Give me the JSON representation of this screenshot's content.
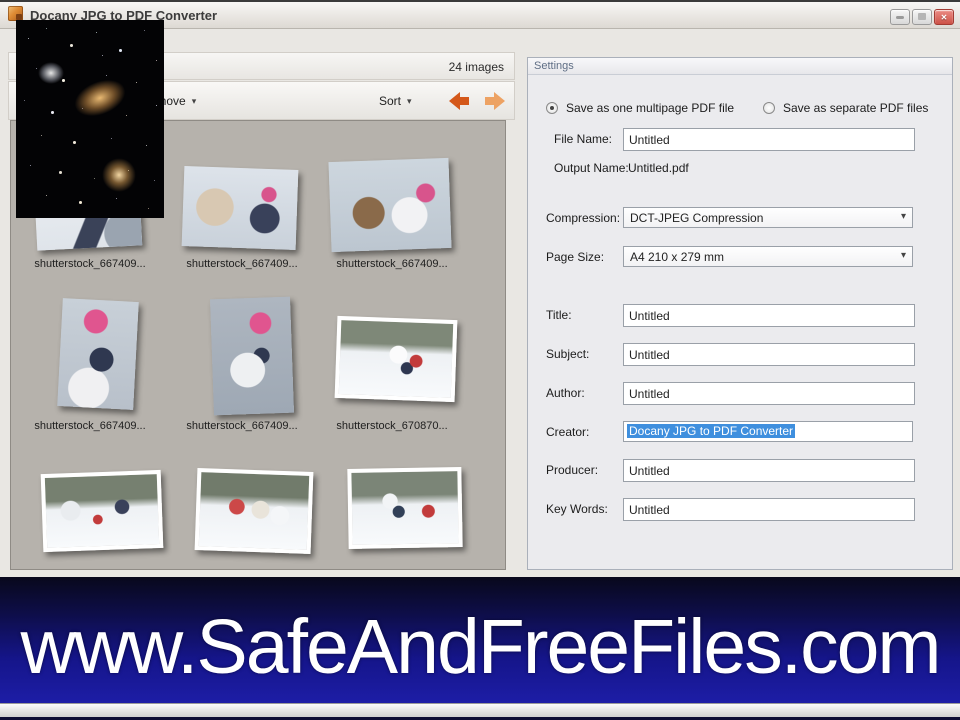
{
  "titlebar": {
    "title": "Docany JPG to PDF Converter",
    "close_glyph": "✕"
  },
  "gallery": {
    "count_label": "24 images",
    "remove_label": "Remove",
    "sort_label": "Sort",
    "caret_glyph": "▾",
    "scroll_up_glyph": "▴",
    "rows": [
      {
        "items": [
          {
            "label": "shutterstock_667409..."
          },
          {
            "label": "shutterstock_667409..."
          },
          {
            "label": "shutterstock_667409..."
          }
        ]
      },
      {
        "items": [
          {
            "label": "shutterstock_667409..."
          },
          {
            "label": "shutterstock_667409..."
          },
          {
            "label": "shutterstock_670870..."
          }
        ]
      },
      {
        "items": [
          {
            "label": ""
          },
          {
            "label": ""
          },
          {
            "label": ""
          }
        ]
      }
    ]
  },
  "overlay_image": {
    "description": "deep space star field photo overlay"
  },
  "settings": {
    "header": "Settings",
    "radio_multipage_label": "Save as one multipage PDF file",
    "radio_separate_label": "Save as separate PDF files",
    "file_name_label": "File Name:",
    "file_name_value": "Untitled",
    "output_name_label": "Output Name:",
    "output_name_value": "Untitled.pdf",
    "compression_label": "Compression:",
    "compression_value": "DCT-JPEG Compression",
    "page_size_label": "Page Size:",
    "page_size_value": "A4 210 x 279 mm",
    "fields": [
      {
        "label": "Title:",
        "value": "Untitled"
      },
      {
        "label": "Subject:",
        "value": "Untitled"
      },
      {
        "label": "Author:",
        "value": "Untitled"
      },
      {
        "label": "Creator:",
        "value": "Docany JPG to PDF Converter"
      },
      {
        "label": "Producer:",
        "value": "Untitled"
      },
      {
        "label": "Key Words:",
        "value": "Untitled"
      }
    ]
  },
  "banner": {
    "text": "www.SafeAndFreeFiles.com"
  },
  "colors": {
    "accent_orange": "#d4581a",
    "accent_orange_light": "#eda263",
    "selection_blue": "#3f8fde",
    "close_red": "#cc5247",
    "banner_blue": "#1d1da6",
    "thumb_area_gray": "#b6b2ac"
  }
}
